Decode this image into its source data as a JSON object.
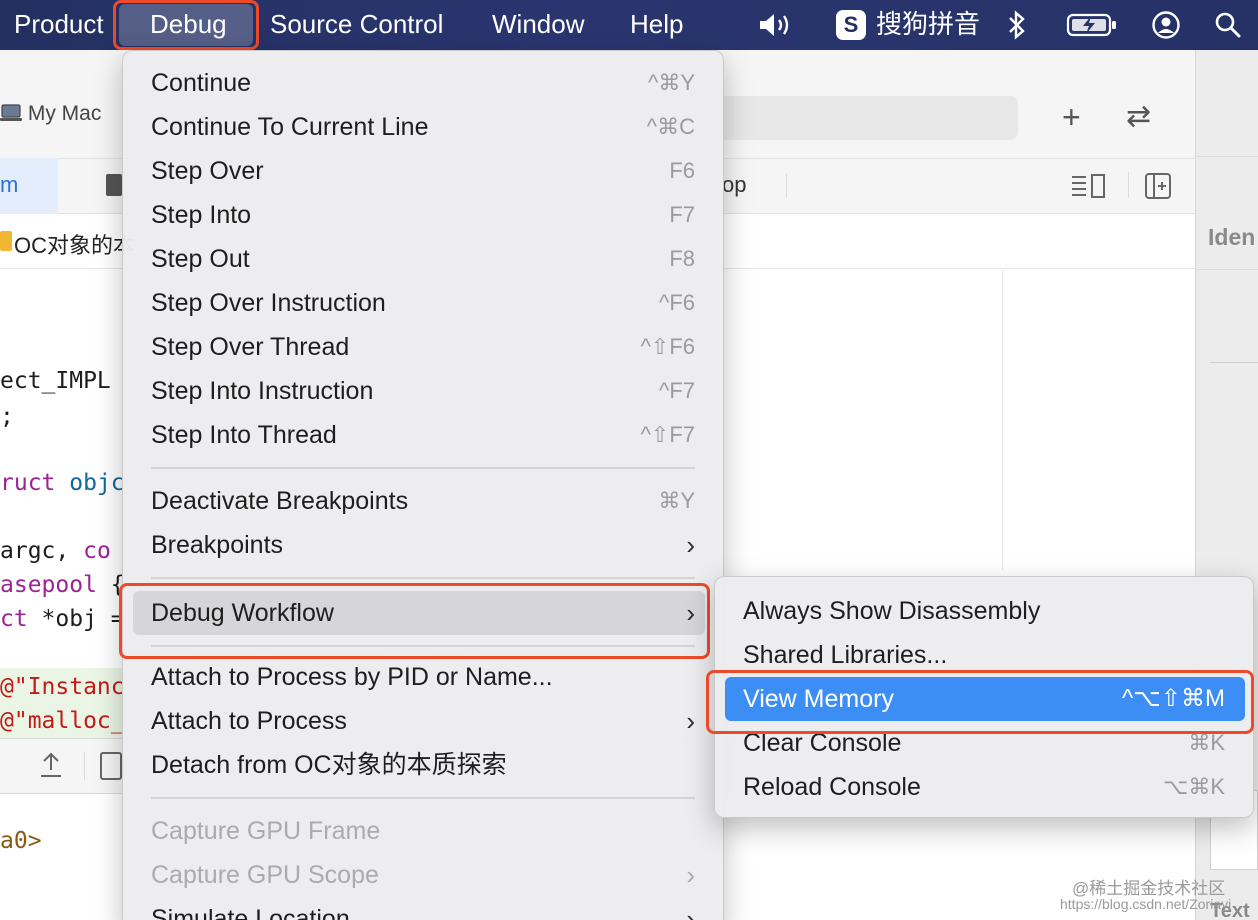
{
  "menubar": {
    "items": [
      "Product",
      "Debug",
      "Source Control",
      "Window",
      "Help"
    ],
    "open_menu": "Debug",
    "ime_label": "搜狗拼音",
    "status_icons": [
      "volume-icon",
      "sogou-input-icon",
      "bluetooth-icon",
      "battery-charging-icon",
      "user-account-icon",
      "search-icon"
    ]
  },
  "xcode": {
    "scheme_target": "My Mac",
    "toolbar_add": "+",
    "toolbar_swap": "⇄",
    "tab_active_fragment": "m",
    "tab_right_fragment": "op",
    "jumpbar_path": "OC对象的本",
    "inspector_label": "Iden",
    "inspector_bottom_label": "Text"
  },
  "code_fragments": {
    "l1": "ect_IMPL",
    "l2": ";",
    "l3_kw": "ruct",
    "l3_type": "objc",
    "l4_plain": " argc, ",
    "l4_kw": "co",
    "l5_kw": "asepool",
    "l5_plain": " {",
    "l6_kw": "ct",
    "l6_plain": " *obj =",
    "l7": "@\"Instanc",
    "l8": "@\"malloc_",
    "console_line": "a0>"
  },
  "debug_menu": {
    "items": [
      {
        "label": "Continue",
        "shortcut": "^⌘Y"
      },
      {
        "label": "Continue To Current Line",
        "shortcut": "^⌘C"
      },
      {
        "label": "Step Over",
        "shortcut": "F6"
      },
      {
        "label": "Step Into",
        "shortcut": "F7"
      },
      {
        "label": "Step Out",
        "shortcut": "F8"
      },
      {
        "label": "Step Over Instruction",
        "shortcut": "^F6"
      },
      {
        "label": "Step Over Thread",
        "shortcut": "^⇧F6"
      },
      {
        "label": "Step Into Instruction",
        "shortcut": "^F7"
      },
      {
        "label": "Step Into Thread",
        "shortcut": "^⇧F7"
      },
      {
        "label": "Deactivate Breakpoints",
        "shortcut": "⌘Y"
      },
      {
        "label": "Breakpoints",
        "shortcut": ""
      },
      {
        "label": "Debug Workflow",
        "shortcut": ""
      },
      {
        "label": "Attach to Process by PID or Name...",
        "shortcut": ""
      },
      {
        "label": "Attach to Process",
        "shortcut": ""
      },
      {
        "label": "Detach from OC对象的本质探索",
        "shortcut": ""
      },
      {
        "label": "Capture GPU Frame",
        "shortcut": ""
      },
      {
        "label": "Capture GPU Scope",
        "shortcut": ""
      },
      {
        "label": "Simulate Location",
        "shortcut": ""
      }
    ],
    "highlighted": "Debug Workflow"
  },
  "workflow_submenu": {
    "items": [
      {
        "label": "Always Show Disassembly",
        "shortcut": ""
      },
      {
        "label": "Shared Libraries...",
        "shortcut": ""
      },
      {
        "label": "View Memory",
        "shortcut": "^⌥⇧⌘M"
      },
      {
        "label": "Clear Console",
        "shortcut": "⌘K"
      },
      {
        "label": "Reload Console",
        "shortcut": "⌥⌘K"
      }
    ],
    "selected": "View Memory"
  },
  "watermark": {
    "line1": "@稀土掘金技术社区",
    "line2": "https://blog.csdn.net/Zoriayi"
  },
  "colors": {
    "menubar_bg": "#263266",
    "highlight_blue": "#3d8ef4",
    "annotation_red": "#ec4a2a",
    "keyword_purple": "#9b2393",
    "string_red": "#c41a16"
  }
}
